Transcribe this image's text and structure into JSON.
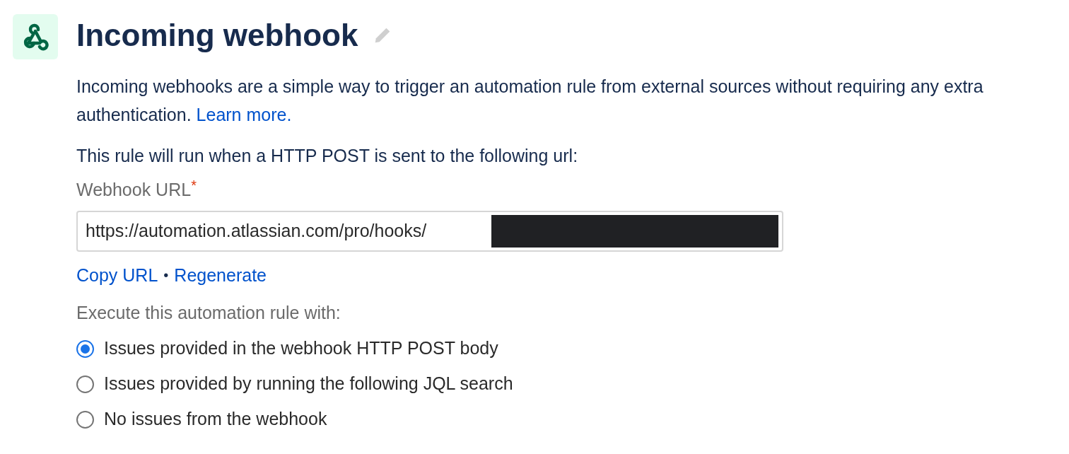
{
  "header": {
    "title": "Incoming webhook"
  },
  "description": {
    "text": "Incoming webhooks are a simple way to trigger an automation rule from external sources without requiring any extra authentication.",
    "link": "Learn more."
  },
  "instruction": "This rule will run when a HTTP POST is sent to the following url:",
  "webhook_url": {
    "label": "Webhook URL",
    "required_mark": "*",
    "value": "https://automation.atlassian.com/pro/hooks/",
    "redacted": true
  },
  "links": [
    {
      "label": "Copy URL"
    },
    {
      "label": "Regenerate"
    }
  ],
  "link_separator": "•",
  "execute_label": "Execute this automation rule with:",
  "options": [
    {
      "label": "Issues provided in the webhook HTTP POST body",
      "selected": true
    },
    {
      "label": "Issues provided by running the following JQL search",
      "selected": false
    },
    {
      "label": "No issues from the webhook",
      "selected": false
    }
  ]
}
